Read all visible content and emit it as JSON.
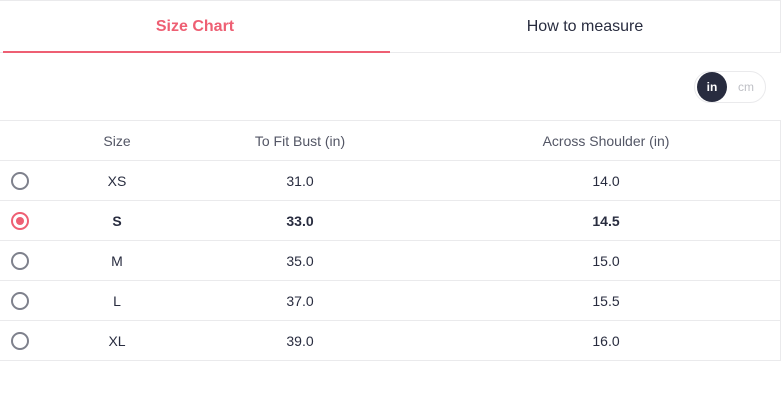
{
  "tabs": [
    {
      "label": "Size Chart",
      "active": true
    },
    {
      "label": "How to measure",
      "active": false
    }
  ],
  "unit_toggle": {
    "options": [
      "in",
      "cm"
    ],
    "selected": "in"
  },
  "table": {
    "headers": [
      "Size",
      "To Fit Bust (in)",
      "Across Shoulder (in)"
    ],
    "rows": [
      {
        "size": "XS",
        "bust": "31.0",
        "shoulder": "14.0",
        "selected": false
      },
      {
        "size": "S",
        "bust": "33.0",
        "shoulder": "14.5",
        "selected": true
      },
      {
        "size": "M",
        "bust": "35.0",
        "shoulder": "15.0",
        "selected": false
      },
      {
        "size": "L",
        "bust": "37.0",
        "shoulder": "15.5",
        "selected": false
      },
      {
        "size": "XL",
        "bust": "39.0",
        "shoulder": "16.0",
        "selected": false
      }
    ]
  },
  "colors": {
    "accent": "#ee5f73",
    "text": "#282c3f",
    "border": "#eaeaec"
  }
}
